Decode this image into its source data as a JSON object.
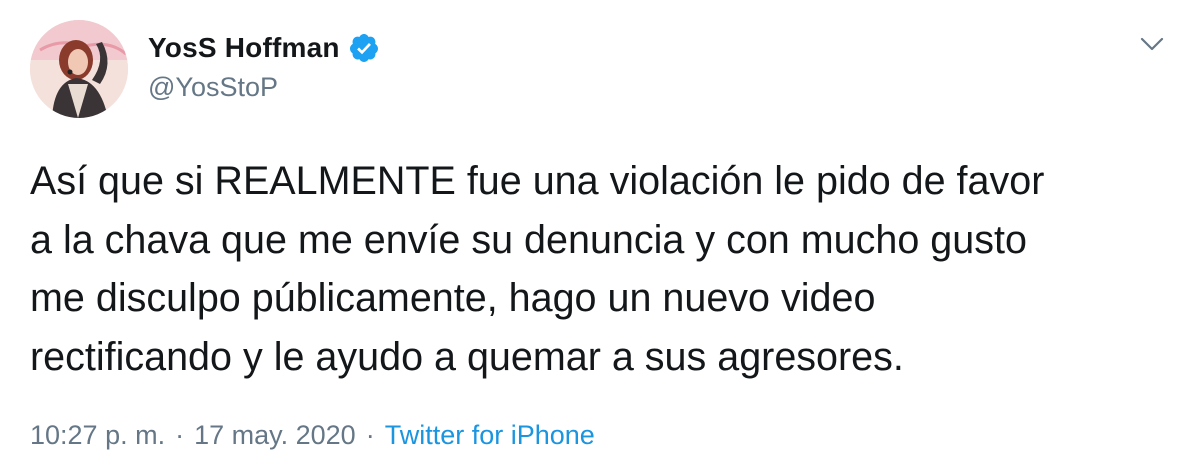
{
  "author": {
    "display_name": "YosS Hoffman",
    "handle": "@YosStoP",
    "verified": true,
    "avatar_icon": "avatar"
  },
  "tweet": {
    "lines": [
      "Así que si REALMENTE fue una violación le pido de favor",
      "a la chava que me envíe su denuncia y con mucho gusto",
      "me disculpo públicamente, hago un nuevo video",
      "rectificando y le ayudo a quemar a sus agresores."
    ]
  },
  "meta": {
    "time": "10:27 p. m.",
    "separator": "·",
    "date": "17 may. 2020",
    "source": "Twitter for iPhone"
  },
  "icons": {
    "verified": "verified-badge-icon",
    "menu": "chevron-down-icon"
  },
  "colors": {
    "text": "#14171a",
    "secondary": "#657786",
    "link": "#1b95e0",
    "verified": "#1da1f2"
  }
}
